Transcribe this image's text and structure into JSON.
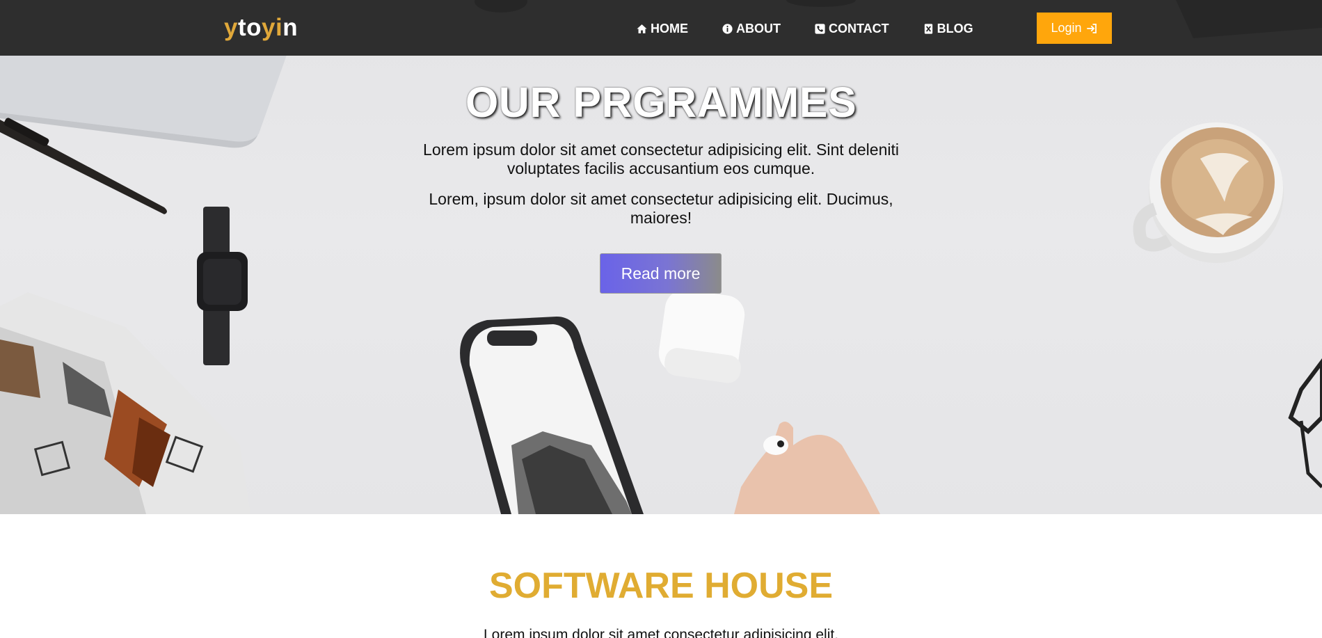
{
  "brand": {
    "logo_parts": [
      "y",
      "to",
      "yi",
      "n"
    ]
  },
  "nav": {
    "items": [
      {
        "label": "HOME",
        "icon": "home-icon"
      },
      {
        "label": "ABOUT",
        "icon": "info-icon"
      },
      {
        "label": "CONTACT",
        "icon": "phone-icon"
      },
      {
        "label": "BLOG",
        "icon": "blog-icon"
      }
    ],
    "login_label": "Login",
    "login_icon": "sign-in-icon"
  },
  "hero": {
    "title": "OUR PRGRAMMES",
    "paragraph1": "Lorem ipsum dolor sit amet consectetur adipisicing elit. Sint deleniti voluptates facilis accusantium eos cumque.",
    "paragraph2": "Lorem, ipsum dolor sit amet consectetur adipisicing elit. Ducimus, maiores!",
    "cta_label": "Read more"
  },
  "section": {
    "title": "SOFTWARE HOUSE",
    "text": "Lorem ipsum dolor sit amet consectetur adipisicing elit."
  },
  "colors": {
    "navbar": "#262626",
    "brand_yellow": "#e0a83a",
    "login_orange": "#ffa60c",
    "section_title": "#e0ac32",
    "cta_start": "#6a63e8",
    "cta_end": "#8b8b8b"
  }
}
